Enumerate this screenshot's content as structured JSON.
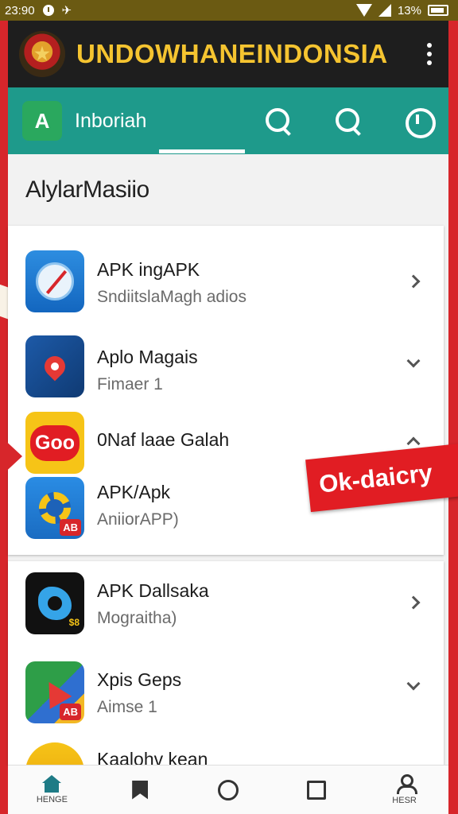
{
  "status_bar": {
    "time": "23:90",
    "battery": "13%"
  },
  "app_bar": {
    "title": "UNDOWHANEINDONSIA"
  },
  "tab_bar": {
    "label": "Inboriah",
    "logo_glyph": "A"
  },
  "content": {
    "section_title": "AlylarMasiio",
    "items": [
      {
        "name": "APK ingAPK",
        "sub": "SndiitslaMagh adios",
        "icon": "compass-icon",
        "chevron": "right"
      },
      {
        "name": "Aplo Magais",
        "sub": "Fimaer 1",
        "icon": "maps-icon",
        "chevron": "down"
      },
      {
        "name": "0Naf laae Galah",
        "sub": "",
        "icon": "goo-icon",
        "icon_text": "Goo",
        "chevron": "up"
      },
      {
        "name": "APK/Apk",
        "sub": "AniiorAPP)",
        "icon": "gear-icon",
        "badge": "AB",
        "chevron": ""
      },
      {
        "name": "APK Dallsaka",
        "sub": "Mograitha)",
        "icon": "flower-icon",
        "badge": "$8",
        "chevron": "right"
      },
      {
        "name": "Xpis Geps",
        "sub": "Aimse 1",
        "icon": "maps-arrow-icon",
        "badge": "AB",
        "chevron": "down"
      },
      {
        "name": "Kaalohv kean",
        "sub": "",
        "icon": "partial-icon",
        "chevron": ""
      }
    ]
  },
  "sticker": {
    "text": "Ok-daicry"
  },
  "bottom_nav": {
    "home_label": "HENGE",
    "profile_label": "HESR"
  },
  "colors": {
    "status_bar": "#6b5a12",
    "app_bar": "#1e1e1e",
    "title": "#f5c430",
    "tab_bar": "#1e9a8b",
    "accent_red": "#e11d23",
    "accent_yellow": "#f6c417"
  }
}
